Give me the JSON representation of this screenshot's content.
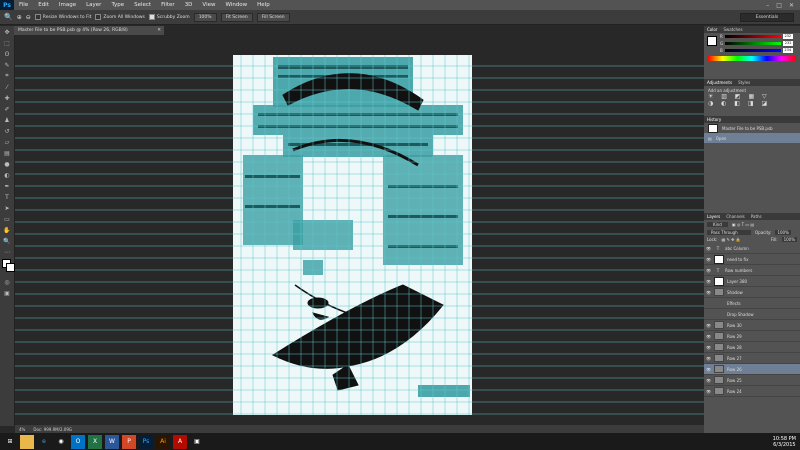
{
  "app": {
    "logo": "Ps"
  },
  "menu": [
    "File",
    "Edit",
    "Image",
    "Layer",
    "Type",
    "Select",
    "Filter",
    "3D",
    "View",
    "Window",
    "Help"
  ],
  "options": {
    "resize_windows": "Resize Windows to Fit",
    "zoom_all": "Zoom All Windows",
    "scrubby_zoom": "Scrubby Zoom",
    "btn_100": "100%",
    "btn_fit": "Fit Screen",
    "btn_fill": "Fill Screen",
    "workspace": "Essentials"
  },
  "document": {
    "tab_title": "Master File to be PSB.psb @ 4% (Row 26, RGB/8)"
  },
  "status": {
    "zoom": "4%",
    "doc": "Doc: 999.9M/2.09G"
  },
  "color_panel": {
    "tabs": [
      "Color",
      "Swatches"
    ],
    "r": "232",
    "g": "232",
    "b": "234"
  },
  "adjustments": {
    "tabs": [
      "Adjustments",
      "Styles"
    ],
    "title": "Add an adjustment"
  },
  "history": {
    "tabs": [
      "History"
    ],
    "items": [
      "Master File to be PSB.psb",
      "Open"
    ]
  },
  "layers": {
    "tabs": [
      "Layers",
      "Channels",
      "Paths"
    ],
    "kind": "Kind",
    "blend": "Pass Through",
    "opacity_label": "Opacity:",
    "opacity": "100%",
    "lock_label": "Lock:",
    "fill_label": "Fill:",
    "fill": "100%",
    "rows": [
      {
        "name": "abc Column",
        "type": "text"
      },
      {
        "name": "need to fix",
        "type": "pixel"
      },
      {
        "name": "Row numbers",
        "type": "text"
      },
      {
        "name": "Layer 380",
        "type": "pixel"
      },
      {
        "name": "Shadow",
        "type": "group"
      },
      {
        "name": "Effects",
        "type": "sub"
      },
      {
        "name": "Drop Shadow",
        "type": "sub"
      },
      {
        "name": "Row 30",
        "type": "group"
      },
      {
        "name": "Row 29",
        "type": "group"
      },
      {
        "name": "Row 28",
        "type": "group"
      },
      {
        "name": "Row 27",
        "type": "group"
      },
      {
        "name": "Row 26",
        "type": "group"
      },
      {
        "name": "Row 25",
        "type": "group"
      },
      {
        "name": "Row 24",
        "type": "group"
      }
    ]
  },
  "taskbar": {
    "time": "10:58 PM",
    "date": "6/3/2015"
  },
  "colors": {
    "accent": "#3a9fa3",
    "guide": "#5ec7cc",
    "panel": "#535353"
  }
}
